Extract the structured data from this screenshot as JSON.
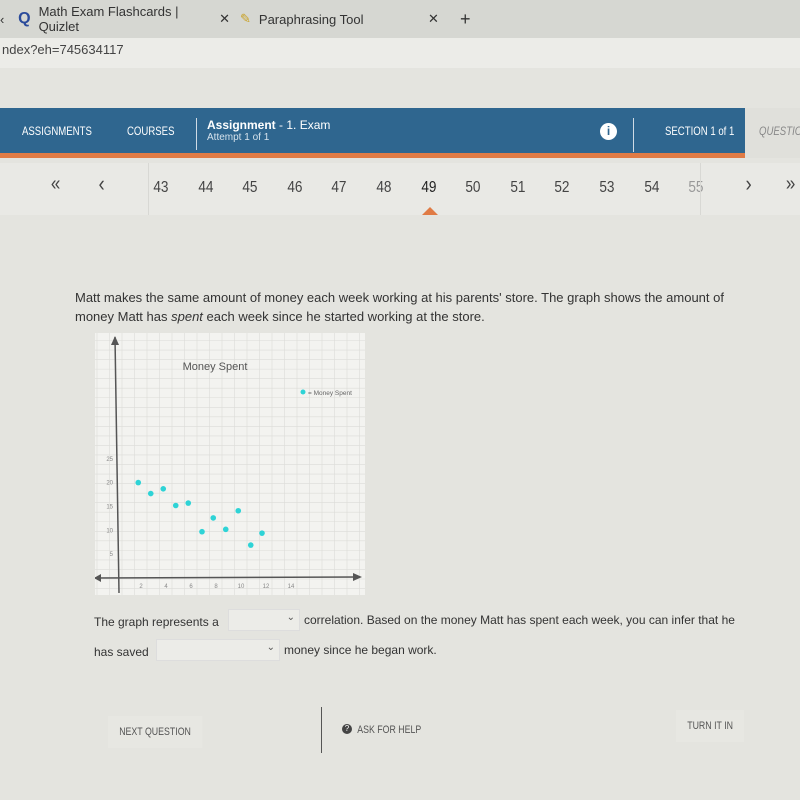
{
  "browser": {
    "tabs": [
      {
        "label": "Math Exam Flashcards | Quizlet",
        "icon": "quizlet-icon"
      },
      {
        "label": "Paraphrasing Tool",
        "icon": "paraphrase-icon"
      }
    ],
    "url": "ndex?eh=745634117"
  },
  "header": {
    "assignments": "ASSIGNMENTS",
    "courses": "COURSES",
    "assignment_title": "Assignment",
    "assignment_name": "- 1. Exam",
    "attempt": "Attempt 1 of 1",
    "section": "SECTION 1 of 1",
    "question": "QUESTION"
  },
  "pager": {
    "pages": [
      "43",
      "44",
      "45",
      "46",
      "47",
      "48",
      "49",
      "50",
      "51",
      "52",
      "53",
      "54",
      "55"
    ],
    "current": "49",
    "first": "«",
    "prev": "‹",
    "next": "›",
    "last": "»"
  },
  "question": {
    "text_before": "Matt makes the same amount of money each week working at his parents' store. The graph shows the amount of money Matt has ",
    "emph": "spent",
    "text_after": " each week since he started working at the store."
  },
  "chart_data": {
    "type": "scatter",
    "title": "Money Spent",
    "legend": "= Money Spent",
    "legend_position": "top-right",
    "grid": true,
    "color": "#2ed3d6",
    "x_ticks": [
      2,
      4,
      6,
      8,
      10,
      12,
      14
    ],
    "y_ticks": [
      5,
      10,
      15,
      20,
      25
    ],
    "xlim": [
      0,
      18
    ],
    "ylim": [
      0,
      35
    ],
    "points": [
      [
        1.7,
        20
      ],
      [
        2.7,
        17.7
      ],
      [
        3.7,
        18.7
      ],
      [
        4.7,
        15.2
      ],
      [
        5.7,
        15.7
      ],
      [
        6.8,
        9.7
      ],
      [
        7.7,
        12.6
      ],
      [
        8.7,
        10.2
      ],
      [
        9.7,
        14.1
      ],
      [
        10.7,
        6.9
      ],
      [
        11.6,
        9.4
      ]
    ]
  },
  "answer": {
    "s1_before": "The graph represents a",
    "s1_after": "correlation. Based on the money Matt has spent each week, you can infer that he",
    "s2_before": "has saved",
    "s2_after": "money since he began work.",
    "dropdown1": "",
    "dropdown2": ""
  },
  "footer": {
    "next": "NEXT QUESTION",
    "help": "ASK FOR HELP",
    "turn_in": "TURN IT IN"
  }
}
